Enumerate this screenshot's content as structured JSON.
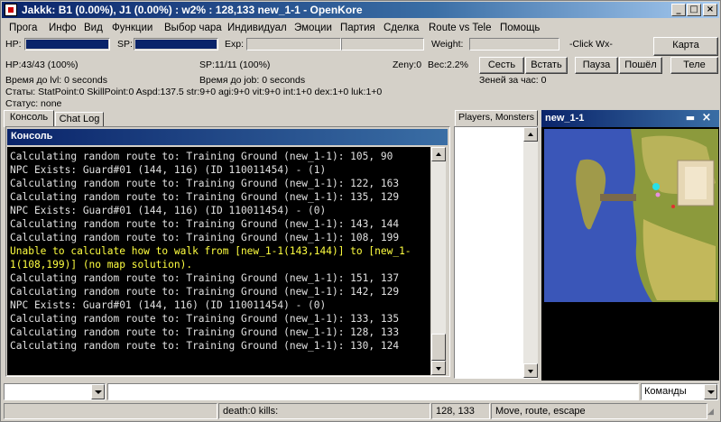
{
  "window": {
    "title": "Jakkk:  B1 (0.00%), J1 (0.00%) : w2% : 128,133 new_1-1 - OpenKore",
    "controls": {
      "minimize": "_",
      "maximize": "□",
      "close": "×"
    }
  },
  "menu": [
    "Прога",
    "Инфо",
    "Вид",
    "Функции",
    "Выбор чара",
    "Индивидуал",
    "Эмоции",
    "Партия",
    "Сделка",
    "Route vs Tele",
    "Помощь"
  ],
  "stats": {
    "hp_label": "HP:",
    "hp_fill": 1.0,
    "sp_label": "SP:",
    "sp_fill": 1.0,
    "exp_label": "Exp:",
    "weight_label": "Weight:",
    "weight_fill": 0.02,
    "click_hint": "-Click Wx-",
    "hp_text": "HP:43/43 (100%)",
    "sp_text": "SP:11/11 (100%)",
    "zeny": "Zeny:0",
    "ves": "Вес:2.2%",
    "time_lvl": "Время до lvl: 0 seconds",
    "time_job": "Время до job: 0 seconds",
    "zeny_hour": "Зеней за час: 0",
    "stats_line": "Статы: StatPoint:0  SkillPoint:0   Aspd:137.5   str:9+0 agi:9+0 vit:9+0 int:1+0 dex:1+0 luk:1+0",
    "status_line": "Статус: none"
  },
  "buttons": {
    "karta": "Карта",
    "sest": "Сесть",
    "vstat": "Встать",
    "pauza": "Пауза",
    "poshel": "Пошёл",
    "tele": "Теле"
  },
  "tabs": {
    "console": "Консоль",
    "chatlog": "Chat Log"
  },
  "console": {
    "header": "Консоль",
    "lines": [
      {
        "text": "Calculating random route to: Training Ground (new_1-1): 105, 90",
        "warn": false
      },
      {
        "text": "NPC Exists: Guard#01 (144, 116) (ID 110011454) - (1)",
        "warn": false
      },
      {
        "text": "Calculating random route to: Training Ground (new_1-1): 122, 163",
        "warn": false
      },
      {
        "text": "Calculating random route to: Training Ground (new_1-1): 135, 129",
        "warn": false
      },
      {
        "text": "NPC Exists: Guard#01 (144, 116) (ID 110011454) - (0)",
        "warn": false
      },
      {
        "text": "Calculating random route to: Training Ground (new_1-1): 143, 144",
        "warn": false
      },
      {
        "text": "Calculating random route to: Training Ground (new_1-1): 108, 199",
        "warn": false
      },
      {
        "text": "Unable to calculate how to walk from [new_1-1(143,144)] to [new_1-",
        "warn": true
      },
      {
        "text": "1(108,199)] (no map solution).",
        "warn": true
      },
      {
        "text": "Calculating random route to: Training Ground (new_1-1): 151, 137",
        "warn": false
      },
      {
        "text": "Calculating random route to: Training Ground (new_1-1): 142, 129",
        "warn": false
      },
      {
        "text": "NPC Exists: Guard#01 (144, 116) (ID 110011454) - (0)",
        "warn": false
      },
      {
        "text": "Calculating random route to: Training Ground (new_1-1): 133, 135",
        "warn": false
      },
      {
        "text": "Calculating random route to: Training Ground (new_1-1): 128, 133",
        "warn": false
      },
      {
        "text": "Calculating random route to: Training Ground (new_1-1): 130, 124",
        "warn": false
      }
    ]
  },
  "players_panel": {
    "header": "Players, Monsters"
  },
  "map": {
    "title": "new_1-1"
  },
  "bottom": {
    "input_left": "",
    "input_main": "",
    "commands": "Команды"
  },
  "statusbar": {
    "kills": "death:0 kills:",
    "coords": "128, 133",
    "mode": "Move, route, escape"
  }
}
